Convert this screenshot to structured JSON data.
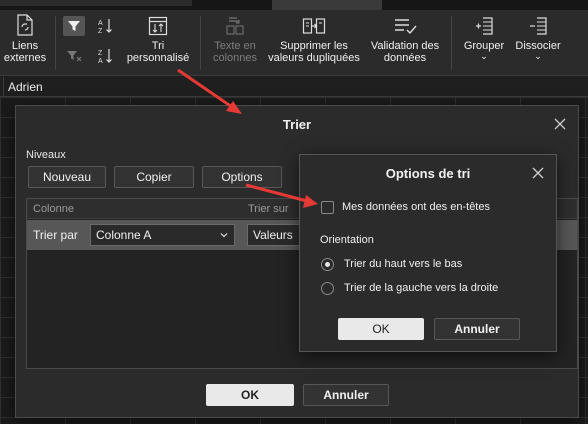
{
  "ribbon": {
    "external_links": "Liens externes",
    "custom_sort": "Tri personnalisé",
    "text_to_columns": "Texte en colonnes",
    "remove_duplicates": "Supprimer les valeurs dupliquées",
    "data_validation": "Validation des données",
    "group": "Grouper",
    "ungroup": "Dissocier",
    "chevron": "⌄"
  },
  "formula_bar": {
    "value": "Adrien"
  },
  "sort_dialog": {
    "title": "Trier",
    "levels_label": "Niveaux",
    "new_button": "Nouveau",
    "copy_button": "Copier",
    "options_button": "Options",
    "col_header_column": "Colonne",
    "col_header_sort_on": "Trier sur",
    "row": {
      "label": "Trier par",
      "column": "Colonne A",
      "sort_on": "Valeurs"
    },
    "ok": "OK",
    "cancel": "Annuler"
  },
  "options_dialog": {
    "title": "Options de tri",
    "has_headers_label": "Mes données ont des en-têtes",
    "has_headers_checked": false,
    "orientation_label": "Orientation",
    "top_to_bottom": "Trier du haut vers le bas",
    "left_to_right": "Trier de la gauche vers la droite",
    "selected_orientation": "top_to_bottom",
    "ok": "OK",
    "cancel": "Annuler"
  },
  "colors": {
    "accent_arrow": "#e53935",
    "primary_button": "#e9e9e9"
  }
}
